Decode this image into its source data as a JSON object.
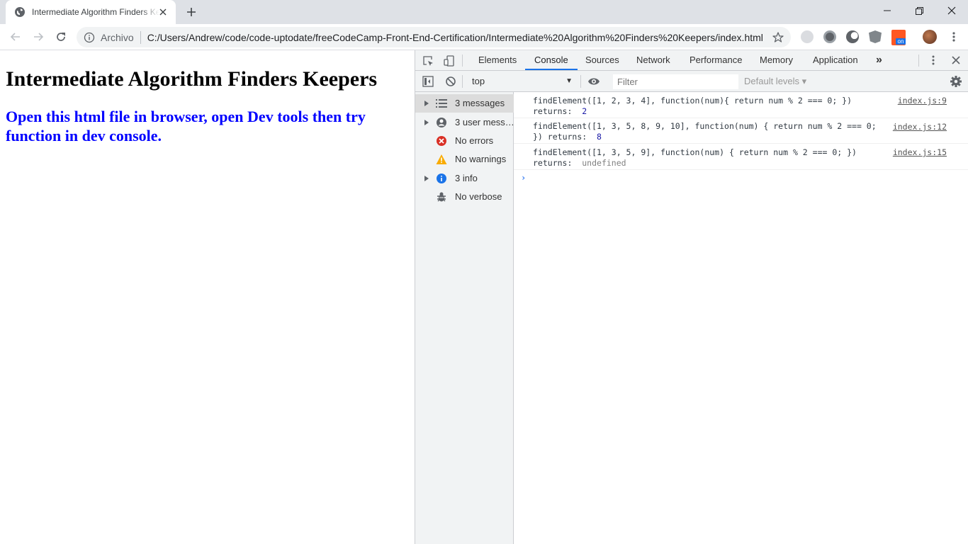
{
  "browser": {
    "tab": {
      "title": "Intermediate Algorithm Finders Keepers"
    },
    "omnibox": {
      "security_label": "Archivo",
      "url": "C:/Users/Andrew/code/code-uptodate/freeCodeCamp-Front-End-Certification/Intermediate%20Algorithm%20Finders%20Keepers/index.html"
    },
    "extensions": [
      "cookie-icon",
      "tampermonkey-icon",
      "dark-reader-icon",
      "angular-icon",
      "extension-on-icon",
      "avatar"
    ],
    "extension_badge": "on"
  },
  "page": {
    "heading": "Intermediate Algorithm Finders Keepers",
    "subheading": "Open this html file in browser, open Dev tools then try function in dev console."
  },
  "devtools": {
    "tabs": [
      "Elements",
      "Console",
      "Sources",
      "Network",
      "Performance",
      "Memory",
      "Application"
    ],
    "active_tab": "Console",
    "more_tabs": "»",
    "context": "top",
    "filter_placeholder": "Filter",
    "levels": "Default levels ▾",
    "sidebar": [
      {
        "label": "3 messages",
        "icon": "list-icon",
        "expandable": true,
        "selected": true
      },
      {
        "label": "3 user mess…",
        "icon": "user-icon",
        "expandable": true
      },
      {
        "label": "No errors",
        "icon": "error-icon",
        "expandable": false
      },
      {
        "label": "No warnings",
        "icon": "warning-icon",
        "expandable": false
      },
      {
        "label": "3 info",
        "icon": "info-icon",
        "expandable": true
      },
      {
        "label": "No verbose",
        "icon": "bug-icon",
        "expandable": false
      }
    ],
    "messages": [
      {
        "code": "findElement([1, 2, 3, 4], function(num){ return num % 2 === 0; })",
        "returns_label": "returns: ",
        "value": "2",
        "source": "index.js:9"
      },
      {
        "code": "findElement([1, 3, 5, 8, 9, 10], function(num) { return num % 2 === 0; })",
        "returns_label": "returns: ",
        "value": "8",
        "source": "index.js:12"
      },
      {
        "code": "findElement([1, 3, 5, 9], function(num) { return num % 2 === 0; })",
        "returns_label": "returns: ",
        "value": "undefined",
        "source": "index.js:15"
      }
    ],
    "prompt": "›"
  },
  "colors": {
    "accent": "#1a73e8",
    "heading_blue": "#0000ff",
    "error": "#d93025",
    "warning": "#f9ab00",
    "info": "#1a73e8"
  }
}
